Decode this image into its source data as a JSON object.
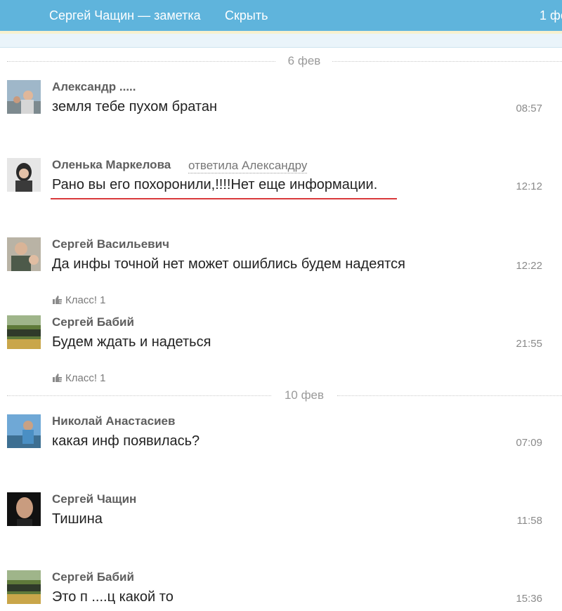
{
  "header": {
    "title": "Сергей Чащин — заметка",
    "hide_label": "Скрыть",
    "count": "1 фе"
  },
  "dates": [
    "6 фев",
    "10 фев"
  ],
  "like_label": "Класс! 1",
  "messages": [
    {
      "author": "Александр .....",
      "text": "земля тебе пухом братан",
      "time": "08:57"
    },
    {
      "author": "Оленька Маркелова",
      "reply": "ответила Александру",
      "text": "Рано вы его похоронили,!!!!Нет еще информации.",
      "time": "12:12"
    },
    {
      "author": "Сергей Васильевич",
      "text": "Да инфы точной нет может ошиблись будем надеятся",
      "time": "12:22"
    },
    {
      "author": "Сергей Бабий",
      "text": "Будем ждать и надеться",
      "time": "21:55"
    },
    {
      "author": "Николай Анастасиев",
      "text": "какая инф появилась?",
      "time": "07:09"
    },
    {
      "author": "Сергей Чащин",
      "text": "Тишина",
      "time": "11:58"
    },
    {
      "author": "Сергей Бабий",
      "text": "Это п ....ц какой то",
      "time": "15:36"
    }
  ],
  "colors": {
    "header_bg": "#5fb4dc",
    "underline": "#d9393b"
  }
}
